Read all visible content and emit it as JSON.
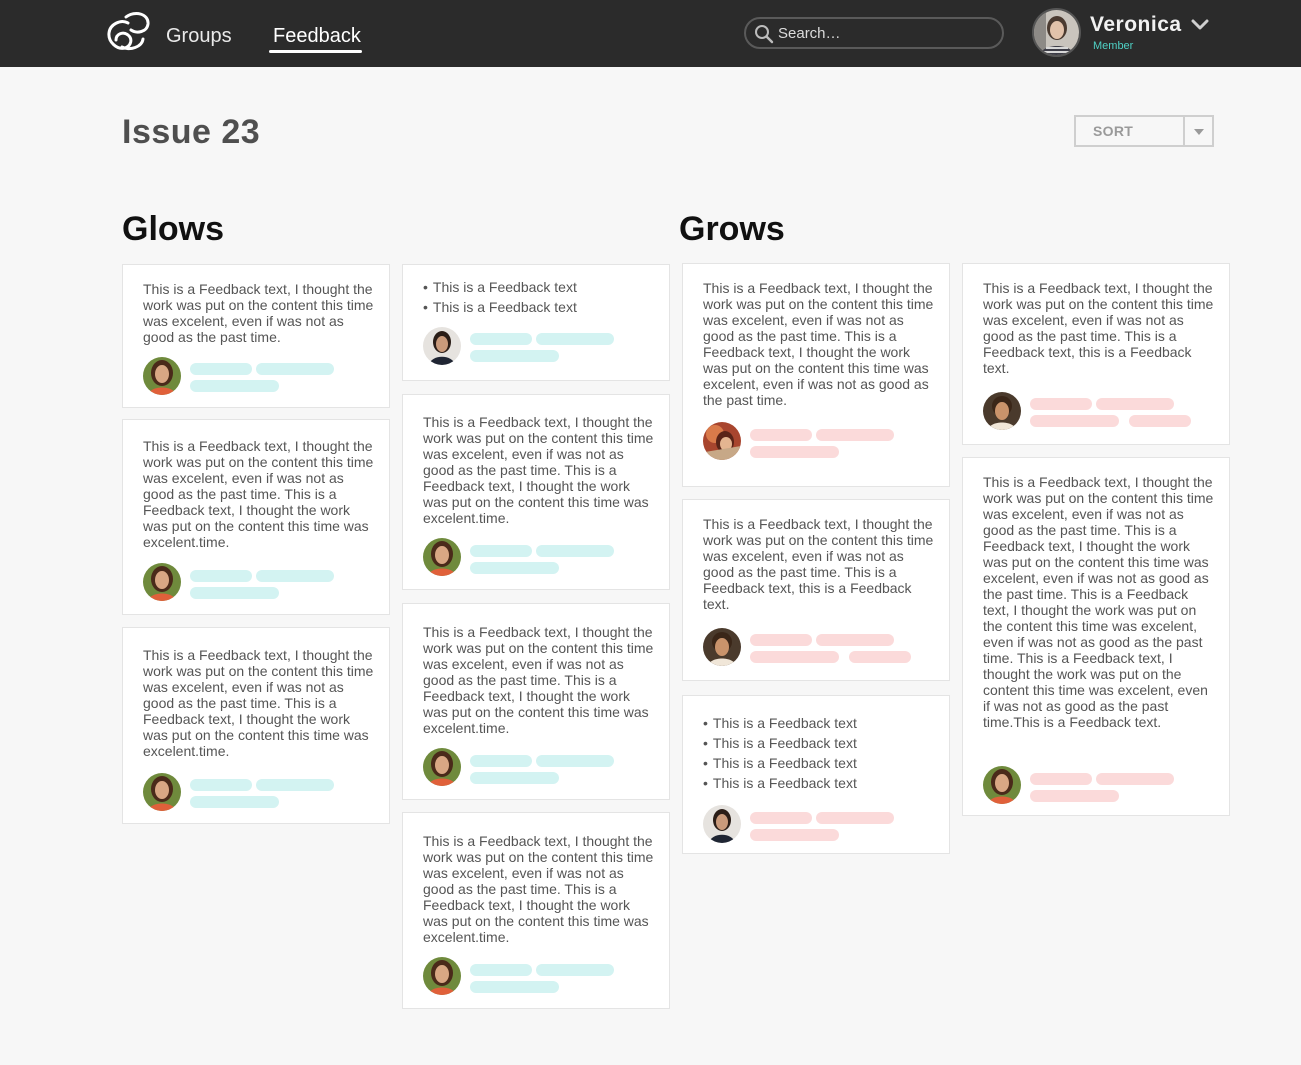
{
  "nav": {
    "groups_label": "Groups",
    "feedback_label": "Feedback",
    "search_placeholder": "Search…",
    "user": {
      "name": "Veronica",
      "role": "Member"
    }
  },
  "page": {
    "title": "Issue 23",
    "sort_label": "SORT"
  },
  "colors": {
    "topbar": "#2b2b2b",
    "glow_accent": "#d3f3f2",
    "grow_accent": "#fbdada",
    "member_role": "#4fd1c5"
  },
  "glows": {
    "title": "Glows",
    "cards": [
      {
        "text": "This is a Feedback text, I thought the work was put on the content this time was excelent, even if was not as good as the past time."
      },
      {
        "bullets": [
          "This is a Feedback text",
          "This is a Feedback text"
        ]
      },
      {
        "text": "This is a Feedback text, I thought the work was put on the content this time was excelent, even if was not as good as the past time. This is a Feedback text, I thought the work was put on the content this time was excelent.time."
      },
      {
        "text": "This is a Feedback text, I thought the work was put on the content this time was excelent, even if was not as good as the past time. This is a Feedback text, I thought the work was put on the content this time was excelent.time."
      },
      {
        "text": "This is a Feedback text, I thought the work was put on the content this time was excelent, even if was not as good as the past time. This is a Feedback text, I thought the work was put on the content this time was excelent.time."
      },
      {
        "text": "This is a Feedback text, I thought the work was put on the content this time was excelent, even if was not as good as the past time. This is a Feedback text, I thought the work was put on the content this time was excelent.time."
      },
      {
        "text": "This is a Feedback text, I thought the work was put on the content this time was excelent, even if was not as good as the past time. This is a Feedback text, I thought the work was put on the content this time was excelent.time."
      }
    ]
  },
  "grows": {
    "title": "Grows",
    "cards": [
      {
        "text": "This is a Feedback text, I thought the work was put on the content this time was excelent, even if was not as good as the past time. This is a Feedback text, I thought the work was put on the content this time was excelent, even if was not as good as the past time."
      },
      {
        "text": "This is a Feedback text, I thought the work was put on the content this time was excelent, even if was not as good as the past time. This is a Feedback text, this is a Feedback text."
      },
      {
        "text": "This is a Feedback text, I thought the work was put on the content this time was excelent, even if was not as good as the past time. This is a Feedback text, this is a Feedback text."
      },
      {
        "text": "This is a Feedback text, I thought the work was put on the content this time was excelent, even if was not as good as the past time. This is a Feedback text, I thought the work was put on the content this time was excelent, even if was not as good as the past time. This is a Feedback text, I thought the work was put on the content this time was excelent, even if was not as good as the past time. This is a Feedback text, I thought the work was put on the content this time was excelent, even if was not as good as the past time.This is a Feedback text."
      },
      {
        "bullets": [
          "This is a Feedback text",
          "This is a Feedback text",
          "This is a Feedback text",
          "This is a Feedback text"
        ]
      }
    ]
  }
}
